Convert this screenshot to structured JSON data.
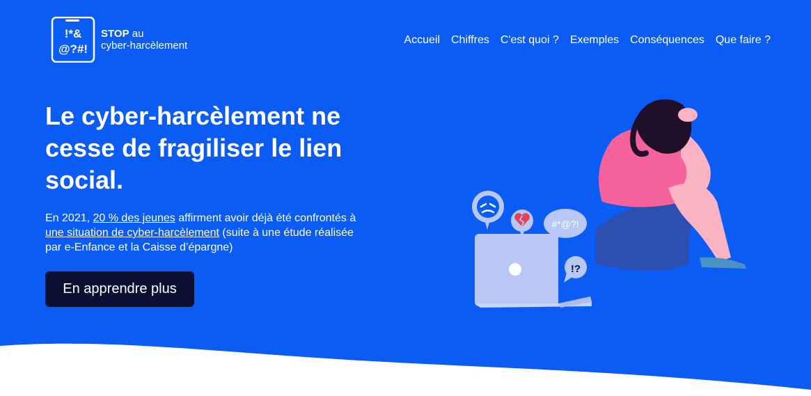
{
  "logo": {
    "symbols_line1": "!*&",
    "symbols_line2": "@?#!",
    "brand_bold": "STOP",
    "brand_rest": " au",
    "brand_line2": "cyber-harcèlement"
  },
  "nav": {
    "items": [
      {
        "label": "Accueil"
      },
      {
        "label": "Chiffres"
      },
      {
        "label": "C'est quoi ?"
      },
      {
        "label": "Exemples"
      },
      {
        "label": "Conséquences"
      },
      {
        "label": "Que faire ?"
      }
    ]
  },
  "hero": {
    "title": "Le cyber-harcèlement ne cesse de fragiliser le lien social.",
    "desc_part1": "En 2021, ",
    "desc_link1": "20 % des jeunes",
    "desc_part2": " affirment avoir déjà été confrontés à ",
    "desc_link2": "une situation de cyber-harcèlement",
    "desc_part3": " (suite à une étude réalisée par e-Enfance et la Caisse d’épargne)",
    "cta_label": "En apprendre plus"
  },
  "illustration": {
    "bubble_text": "#*@?!",
    "alert_text": "!?"
  },
  "colors": {
    "hero_background": "#0a5cf5",
    "button_background": "#0b1033",
    "laptop": "#b8c7f5",
    "shirt": "#f6629b",
    "jeans": "#2e4fb2",
    "hair": "#1f0f29"
  }
}
